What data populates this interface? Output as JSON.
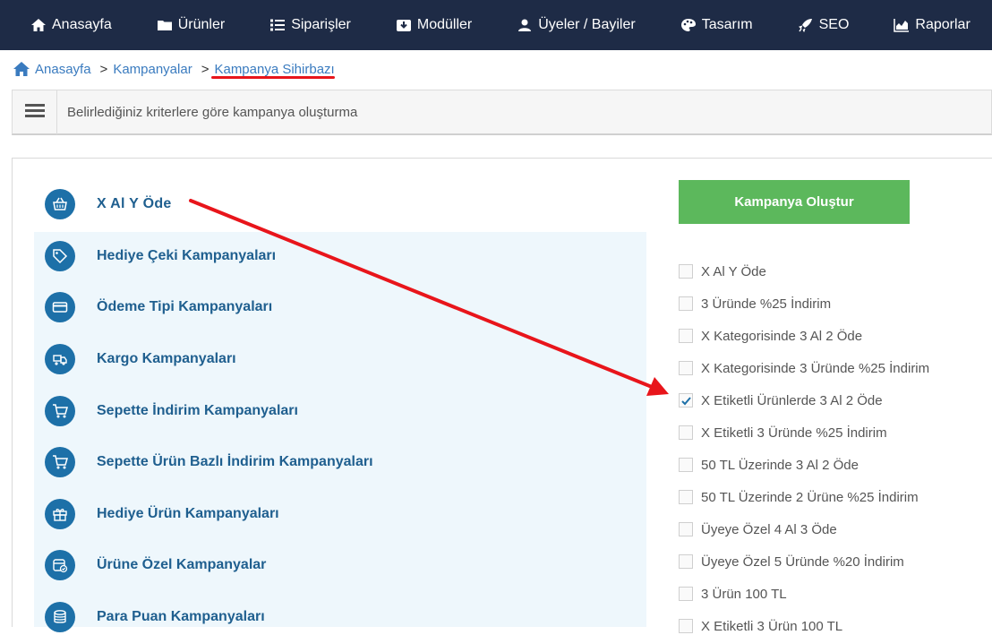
{
  "nav": {
    "items": [
      {
        "label": "Anasayfa",
        "icon": "home-icon"
      },
      {
        "label": "Ürünler",
        "icon": "folder-icon"
      },
      {
        "label": "Siparişler",
        "icon": "list-icon"
      },
      {
        "label": "Modüller",
        "icon": "download-box-icon"
      },
      {
        "label": "Üyeler / Bayiler",
        "icon": "user-icon"
      },
      {
        "label": "Tasarım",
        "icon": "palette-icon"
      },
      {
        "label": "SEO",
        "icon": "rocket-icon"
      },
      {
        "label": "Raporlar",
        "icon": "chart-icon"
      }
    ]
  },
  "breadcrumb": {
    "home": "Anasayfa",
    "level2": "Kampanyalar",
    "current": "Kampanya Sihirbazı",
    "sep": ">"
  },
  "infobar": {
    "text": "Belirlediğiniz kriterlere göre kampanya oluşturma"
  },
  "campaigns": [
    {
      "label": "X Al Y Öde",
      "icon": "basket-icon"
    },
    {
      "label": "Hediye Çeki Kampanyaları",
      "icon": "tag-icon"
    },
    {
      "label": "Ödeme Tipi Kampanyaları",
      "icon": "credit-card-icon"
    },
    {
      "label": "Kargo Kampanyaları",
      "icon": "cargo-icon"
    },
    {
      "label": "Sepette İndirim Kampanyaları",
      "icon": "cart-icon"
    },
    {
      "label": "Sepette Ürün Bazlı İndirim Kampanyaları",
      "icon": "cart-icon"
    },
    {
      "label": "Hediye Ürün Kampanyaları",
      "icon": "gift-icon"
    },
    {
      "label": "Ürüne Özel Kampanyalar",
      "icon": "product-badge-icon"
    },
    {
      "label": "Para Puan Kampanyaları",
      "icon": "coins-icon"
    }
  ],
  "create_button": "Kampanya Oluştur",
  "options": [
    {
      "label": "X Al Y Öde",
      "checked": false
    },
    {
      "label": "3 Üründe %25 İndirim",
      "checked": false
    },
    {
      "label": "X Kategorisinde 3 Al 2 Öde",
      "checked": false
    },
    {
      "label": "X Kategorisinde 3 Üründe %25 İndirim",
      "checked": false
    },
    {
      "label": "X Etiketli Ürünlerde 3 Al 2 Öde",
      "checked": true
    },
    {
      "label": "X Etiketli 3 Üründe %25 İndirim",
      "checked": false
    },
    {
      "label": "50 TL Üzerinde 3 Al 2 Öde",
      "checked": false
    },
    {
      "label": "50 TL Üzerinde 2 Ürüne %25 İndirim",
      "checked": false
    },
    {
      "label": "Üyeye Özel 4 Al 3 Öde",
      "checked": false
    },
    {
      "label": "Üyeye Özel 5 Üründe %20 İndirim",
      "checked": false
    },
    {
      "label": "3 Ürün 100 TL",
      "checked": false
    },
    {
      "label": "X Etiketli 3 Ürün 100 TL",
      "checked": false
    }
  ],
  "colors": {
    "nav_bg": "#1e2b46",
    "accent_blue": "#1d70a8",
    "button_green": "#5cb85c",
    "annotation_red": "#e8151b",
    "list_bg": "#eef7fc"
  }
}
